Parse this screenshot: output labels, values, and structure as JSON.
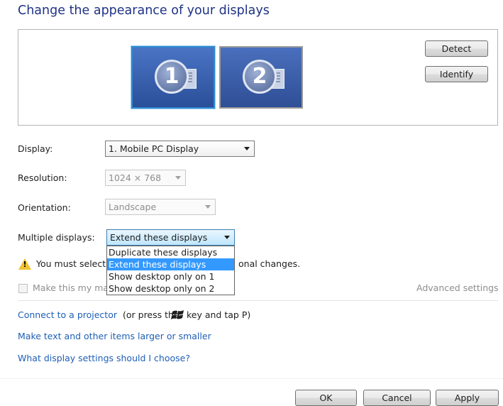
{
  "header": {
    "title": "Change the appearance of your displays"
  },
  "preview": {
    "monitors": [
      {
        "number": "1"
      },
      {
        "number": "2"
      }
    ],
    "detect_label": "Detect",
    "identify_label": "Identify"
  },
  "settings": {
    "display_label": "Display:",
    "display_value": "1. Mobile PC Display",
    "resolution_label": "Resolution:",
    "resolution_value": "1024 × 768",
    "orientation_label": "Orientation:",
    "orientation_value": "Landscape",
    "multiple_label": "Multiple displays:",
    "multiple_value": "Extend these displays",
    "multiple_options": [
      "Duplicate these displays",
      "Extend these displays",
      "Show desktop only on 1",
      "Show desktop only on 2"
    ]
  },
  "warning": {
    "text_a": "You must select",
    "text_b": "onal changes."
  },
  "primary": {
    "checkbox_label": "Make this my ma",
    "advanced_link": "Advanced settings"
  },
  "links": {
    "projector_link": "Connect to a projector",
    "projector_rest": "(or press the",
    "projector_rest2": "key and tap P)",
    "text_size": "Make text and other items larger or smaller",
    "help": "What display settings should I choose?"
  },
  "footer": {
    "ok": "OK",
    "cancel": "Cancel",
    "apply": "Apply"
  },
  "colors": {
    "title": "#1e3287",
    "link": "#1f5fb6",
    "selection": "#3399ff",
    "warning": "#f1c232"
  }
}
